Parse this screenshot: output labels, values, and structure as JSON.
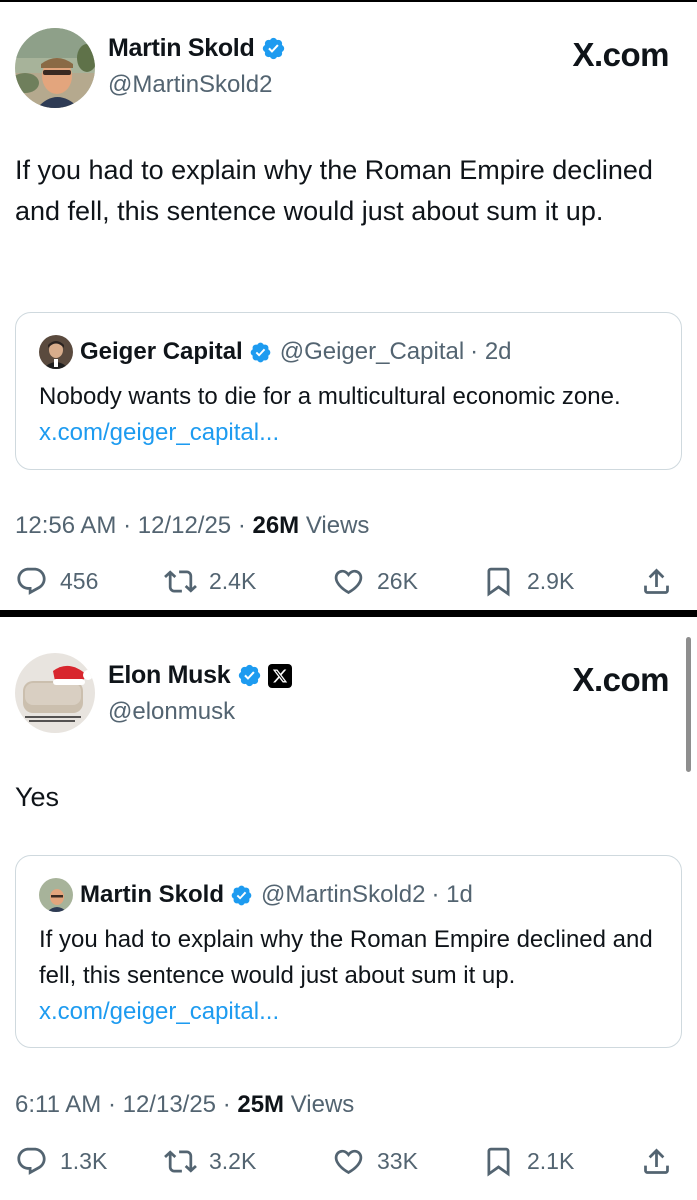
{
  "tweets": [
    {
      "name": "Martin Skold",
      "handle": "@MartinSkold2",
      "brand": "X.com",
      "text": "If you had to explain why the Roman Empire declined and fell, this sentence would just about sum it up.",
      "quote": {
        "name": "Geiger Capital",
        "handle": "@Geiger_Capital",
        "time": "· 2d",
        "text": "Nobody wants to die for a multicultural economic zone.",
        "link": "x.com/geiger_capital..."
      },
      "time": "12:56 AM · 12/12/25 · ",
      "views_count": "26M",
      "views_label": " Views",
      "actions": {
        "replies": "456",
        "reposts": "2.4K",
        "likes": "26K",
        "bookmarks": "2.9K"
      }
    },
    {
      "name": "Elon Musk",
      "handle": "@elonmusk",
      "brand": "X.com",
      "text": "Yes",
      "quote": {
        "name": "Martin Skold",
        "handle": "@MartinSkold2",
        "time": "· 1d",
        "text": "If you had to explain why the Roman Empire declined and fell, this sentence would just about sum it up.",
        "link": "x.com/geiger_capital..."
      },
      "time": "6:11 AM · 12/13/25 · ",
      "views_count": "25M",
      "views_label": " Views",
      "actions": {
        "replies": "1.3K",
        "reposts": "3.2K",
        "likes": "33K",
        "bookmarks": "2.1K"
      }
    }
  ],
  "colors": {
    "verified": "#1d9bf0",
    "link": "#1d9bf0",
    "secondary_text": "#536471",
    "border": "#cfd9de"
  },
  "icons": [
    "verified-badge-icon",
    "x-affiliate-badge-icon",
    "reply-icon",
    "repost-icon",
    "like-icon",
    "bookmark-icon",
    "share-icon"
  ]
}
